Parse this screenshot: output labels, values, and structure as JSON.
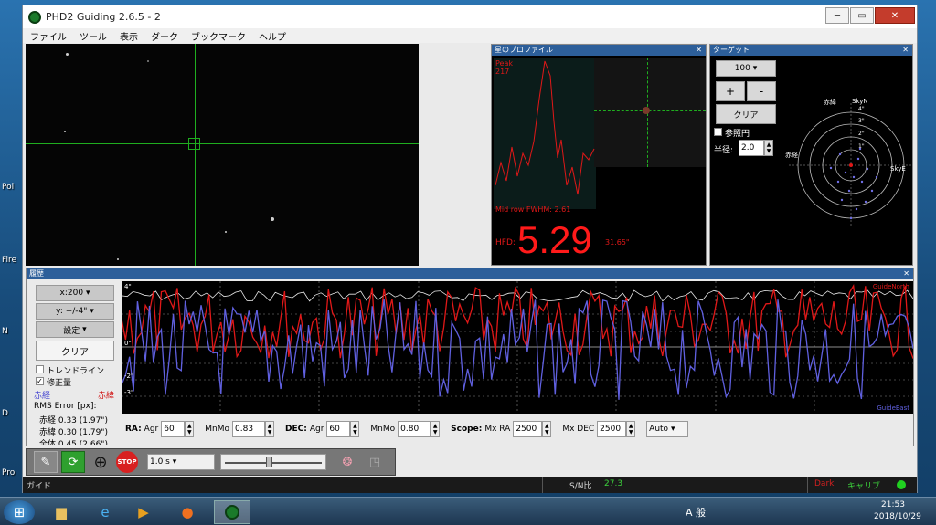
{
  "window": {
    "title": "PHD2 Guiding 2.6.5 - 2",
    "minimize": "─",
    "restore": "▭",
    "close": "✕"
  },
  "menu": [
    "ファイル",
    "ツール",
    "表示",
    "ダーク",
    "ブックマーク",
    "ヘルプ"
  ],
  "desktop_icons": [
    "Pol",
    "Fire",
    "N",
    "D",
    "Pro"
  ],
  "star_profile": {
    "title": "星のプロファイル",
    "close": "✕",
    "peak_label": "Peak",
    "peak_value": "217",
    "midrow": "Mid row FWHM: 2.61",
    "hfd_label": "HFD:",
    "hfd_value": "5.29",
    "hfd_arcsec": "31.65\""
  },
  "target": {
    "title": "ターゲット",
    "close": "✕",
    "zoom": "100",
    "plus": "+",
    "minus": "-",
    "clear": "クリア",
    "ref_circle_label": "参照円",
    "radius_label": "半径:",
    "radius_value": "2.0",
    "ra_label": "赤緯",
    "skyn": "SkyN",
    "dec_label": "赤経",
    "skye": "SkyE",
    "rings": [
      "4\"",
      "3\"",
      "2\"",
      "1\""
    ]
  },
  "history": {
    "title": "履歴",
    "close": "✕",
    "x_scale": "x:200",
    "y_scale": "y: +/-4\"",
    "settings": "設定",
    "clear": "クリア",
    "trendline_label": "トレンドライン",
    "correction_label": "修正量",
    "correction_checked": true,
    "ra_legend": "赤経",
    "dec_legend": "赤緯",
    "rms_title": "RMS Error [px]:",
    "rms_ra": "赤経 0.33 (1.97\")",
    "rms_dec": "赤緯 0.30 (1.79\")",
    "rms_total": "全体 0.45 (2.66\")",
    "y_top": "4\"",
    "y_mid": "0\"",
    "y_low": "-2\"",
    "y_bottom": "-3\"",
    "guide_north": "GuideNorth",
    "guide_east": "GuideEast"
  },
  "controls": {
    "ra_label": "RA:",
    "ra_agr_label": "Agr",
    "ra_agr": "60",
    "ra_mnmo_label": "MnMo",
    "ra_mnmo": "0.83",
    "dec_label": "DEC:",
    "dec_agr_label": "Agr",
    "dec_agr": "60",
    "dec_mnmo_label": "MnMo",
    "dec_mnmo": "0.80",
    "scope_label": "Scope:",
    "mx_ra_label": "Mx RA",
    "mx_ra": "2500",
    "mx_dec_label": "Mx DEC",
    "mx_dec": "2500",
    "mode": "Auto"
  },
  "toolbar": {
    "exposure": "1.0 s",
    "exposure_level": 0.45,
    "stop_label": "STOP"
  },
  "status": {
    "left": "ガイド",
    "sn_label": "S/N比",
    "sn_value": "27.3",
    "dark": "Dark",
    "calib": "キャリブ"
  },
  "taskbar": {
    "ime": "A 般",
    "time": "21:53",
    "date": "2018/10/29"
  },
  "colors": {
    "ra": "#6060e0",
    "dec": "#e01818",
    "grid": "#9a9a9a",
    "green": "#18c018"
  }
}
